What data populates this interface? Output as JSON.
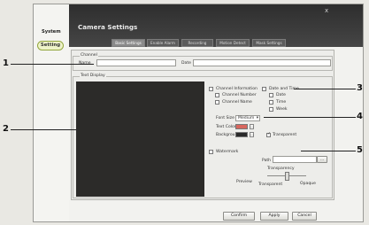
{
  "dialog": {
    "title": "Camera Settings",
    "close": "x"
  },
  "sidebar": {
    "system_label": "System",
    "setting_label": "Setting"
  },
  "tabs": [
    {
      "label": "Basic Settings",
      "active": true
    },
    {
      "label": "Enable Alarm",
      "active": false
    },
    {
      "label": "Recording",
      "active": false
    },
    {
      "label": "Motion Detect",
      "active": false
    },
    {
      "label": "Mask Settings",
      "active": false
    }
  ],
  "channel": {
    "group_label": "Channel",
    "name_label": "Name",
    "name_value": "",
    "date_label": "Date",
    "date_value": ""
  },
  "text_display": {
    "group_label": "Text Display"
  },
  "options": {
    "channel_information": "Channel Information",
    "channel_number": "Channel Number",
    "channel_name": "Channel Name",
    "date_and_time": "Date and Time",
    "date": "Date",
    "time": "Time",
    "week": "Week",
    "font_size_label": "Font Size",
    "font_size_value": "Medium",
    "text_color_label": "Text Color",
    "background_label": "Background",
    "transparent_label": "Transparent",
    "watermark_label": "Watermark",
    "path_label": "Path",
    "transparency_label": "Transparency",
    "preview_label": "Preview",
    "slider_min_label": "Transparent",
    "slider_max_label": "Opaque"
  },
  "colors": {
    "text_color": "#d8665d",
    "background_color": "#2a2a2a"
  },
  "buttons": {
    "confirm": "Confirm",
    "apply": "Apply",
    "cancel": "Cancel"
  },
  "callouts": [
    "1",
    "2",
    "3",
    "4",
    "5"
  ]
}
